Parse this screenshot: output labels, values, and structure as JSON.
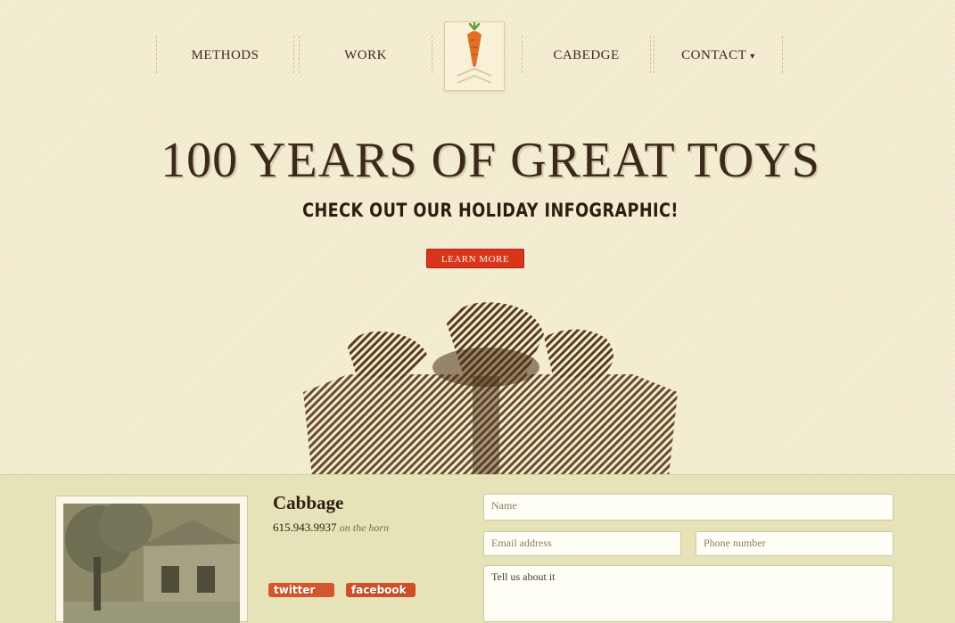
{
  "nav": {
    "items": [
      {
        "label": "METHODS",
        "has_dropdown": false
      },
      {
        "label": "WORK",
        "has_dropdown": false
      },
      {
        "label": "CABEDGE",
        "has_dropdown": false
      },
      {
        "label": "CONTACT",
        "has_dropdown": true
      }
    ]
  },
  "hero": {
    "title": "100 YEARS OF GREAT TOYS",
    "subtitle": "CHECK OUT OUR HOLIDAY INFOGRAPHIC!",
    "button_label": "LEARN MORE"
  },
  "footer": {
    "business_name": "Cabbage",
    "phone": "615.943.9937",
    "phone_note": "on the horn",
    "social": {
      "twitter": "twitter",
      "facebook": "facebook"
    },
    "form": {
      "name_placeholder": "Name",
      "email_placeholder": "Email address",
      "phone_placeholder": "Phone number",
      "message_placeholder": "Tell us about it"
    }
  },
  "colors": {
    "background": "#f4edd0",
    "accent_red": "#d9341c",
    "text_brown": "#3b2a1a",
    "footer_bg": "#e6e3b8",
    "carrot": "#e0702a",
    "leaf": "#6c9a32"
  },
  "icons": {
    "logo": "carrot-icon",
    "gift_illustration": "gift-box-illustration",
    "dropdown": "chevron-down-icon"
  }
}
